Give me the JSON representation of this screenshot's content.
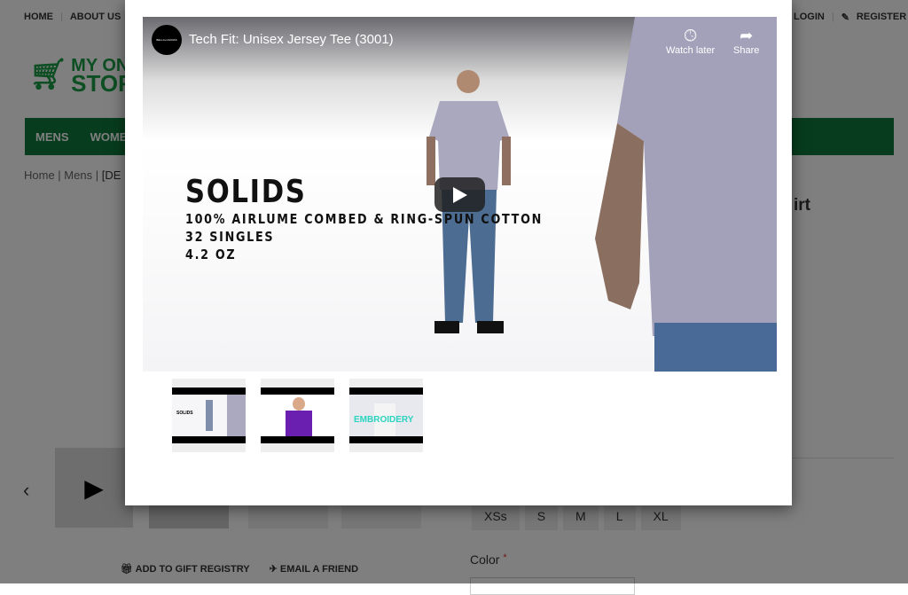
{
  "top_nav": {
    "home": "HOME",
    "about": "ABOUT US",
    "login": "LOGIN",
    "register": "REGISTER"
  },
  "logo": {
    "line1": "MY ONLINE",
    "line2": "STORE"
  },
  "main_nav": [
    "MENS",
    "WOMENS"
  ],
  "breadcrumb": [
    "Home",
    "Mens",
    "[DE"
  ],
  "product_title_fragment": "irt",
  "sizes": [
    "XSs",
    "S",
    "M",
    "L",
    "XL"
  ],
  "color_label": "Color",
  "required_mark": "*",
  "actions": {
    "gift": "ADD TO GIFT REGISTRY",
    "email": "EMAIL A FRIEND"
  },
  "video": {
    "channel": "BELLA+CANVAS",
    "title": "Tech Fit: Unisex Jersey Tee (3001)",
    "watch_later": "Watch later",
    "share": "Share",
    "overlay_heading": "SOLIDS",
    "overlay_lines": [
      "100% AIRLUME COMBED & RING-SPUN COTTON",
      "32 SINGLES",
      "4.2 OZ"
    ]
  },
  "thumbnails": [
    {
      "caption": "SOLIDS"
    },
    {
      "caption": ""
    },
    {
      "caption": "EMBROIDERY"
    }
  ],
  "colors": {
    "brand_green": "#0f7a3c",
    "accent_teal": "#2ad4c0"
  }
}
